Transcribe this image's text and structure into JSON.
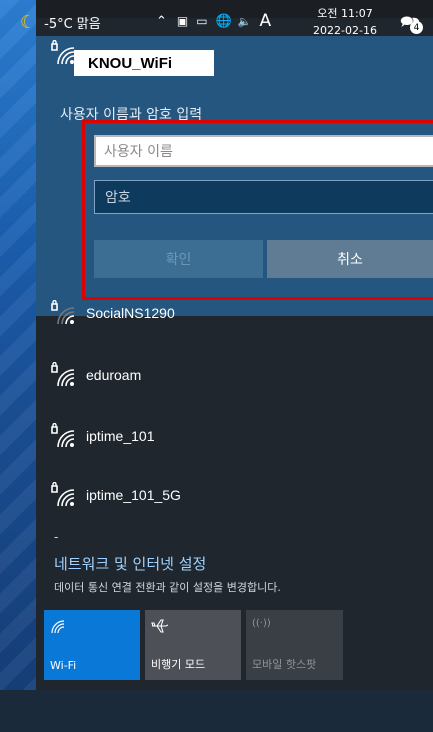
{
  "selected_network": {
    "ssid": "KNOU_WiFi",
    "prompt": "사용자 이름과 암호 입력",
    "username_placeholder": "사용자 이름",
    "password_placeholder": "암호",
    "ok_label": "확인",
    "cancel_label": "취소"
  },
  "networks": [
    {
      "name": "SocialNS1290",
      "icon": "wifi-secured-weak-icon"
    },
    {
      "name": "eduroam",
      "icon": "wifi-secured-icon"
    },
    {
      "name": "iptime_101",
      "icon": "wifi-secured-icon"
    },
    {
      "name": "iptime_101_5G",
      "icon": "wifi-secured-icon"
    }
  ],
  "settings": {
    "title": "네트워크 및 인터넷 설정",
    "description": "데이터 통신 연결 전환과 같이 설정을 변경합니다."
  },
  "tiles": [
    {
      "label": "Wi-Fi",
      "icon": "wifi-icon",
      "active": true
    },
    {
      "label": "비행기 모드",
      "icon": "airplane-icon",
      "active": false
    },
    {
      "label": "모바일 핫스팟",
      "icon": "hotspot-icon",
      "active": false
    }
  ],
  "taskbar": {
    "weather": "-5°C 맑음",
    "time": "오전 11:07",
    "date": "2022-02-16",
    "ime": "A",
    "notification_count": "4"
  },
  "colors": {
    "accent": "#0a78d7",
    "selected_bg": "#24567f",
    "highlight_frame": "#e00000"
  }
}
